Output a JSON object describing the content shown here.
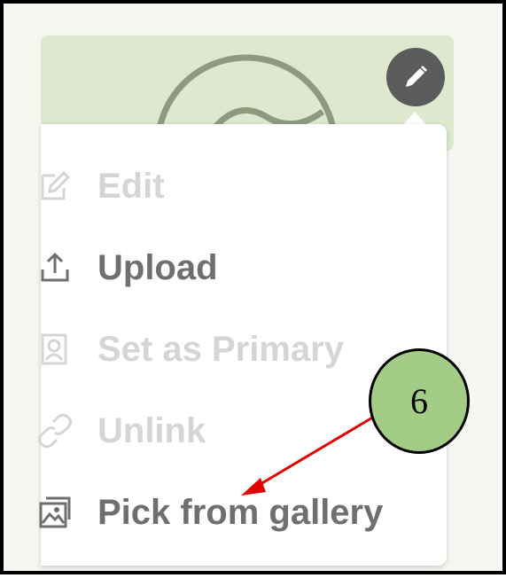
{
  "menu": {
    "items": [
      {
        "label": "Edit",
        "icon": "pencil-square-icon",
        "enabled": false
      },
      {
        "label": "Upload",
        "icon": "upload-icon",
        "enabled": true
      },
      {
        "label": "Set as Primary",
        "icon": "portrait-icon",
        "enabled": false
      },
      {
        "label": "Unlink",
        "icon": "link-icon",
        "enabled": false
      },
      {
        "label": "Pick from gallery",
        "icon": "gallery-icon",
        "enabled": true
      }
    ]
  },
  "edit_button": {
    "icon": "pencil-icon"
  },
  "callout": {
    "number": "6"
  },
  "colors": {
    "card_background": "#dde8cf",
    "edit_button": "#5b5b5b",
    "enabled_text": "#6f6f6f",
    "disabled_text": "#d5d5d5",
    "callout_fill": "#a3cd86",
    "arrow": "#e00000"
  }
}
